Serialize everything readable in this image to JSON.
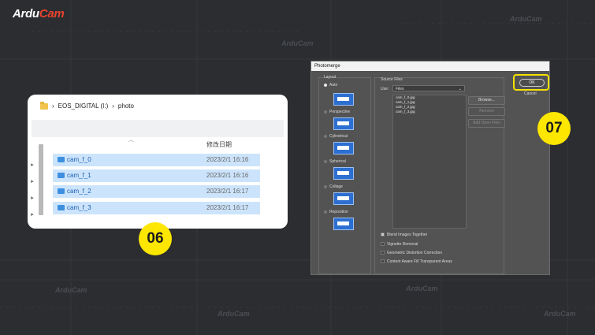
{
  "brand": {
    "name_part1": "Ardu",
    "name_part2": "Cam"
  },
  "watermarks": [
    "ArduCam",
    "ArduCam",
    "ArduCam",
    "ArduCam",
    "ArduCam",
    "ArduCam"
  ],
  "explorer": {
    "breadcrumb": [
      "EOS_DIGITAL (I:)",
      "photo"
    ],
    "separator": "›",
    "column_date": "修改日期",
    "files": [
      {
        "name": "cam_f_0",
        "date": "2023/2/1 16:16"
      },
      {
        "name": "cam_f_1",
        "date": "2023/2/1 16:16"
      },
      {
        "name": "cam_f_2",
        "date": "2023/2/1 16:17"
      },
      {
        "name": "cam_f_3",
        "date": "2023/2/1 16:17"
      }
    ]
  },
  "dialog": {
    "title": "Photomerge",
    "layout_heading": "Layout",
    "layout_options": [
      "Auto",
      "Perspective",
      "Cylindrical",
      "Spherical",
      "Collage",
      "Reposition"
    ],
    "source_heading": "Source Files",
    "use_label": "Use:",
    "use_value": "Files",
    "source_files": [
      "cam_f_0.jpg",
      "cam_f_1.jpg",
      "cam_f_2.jpg",
      "cam_f_3.jpg"
    ],
    "browse_label": "Browse...",
    "remove_label": "Remove",
    "add_open_label": "Add Open Files",
    "ok_label": "OK",
    "cancel_label": "Cancel",
    "options": [
      {
        "label": "Blend Images Together",
        "checked": true
      },
      {
        "label": "Vignette Removal",
        "checked": false
      },
      {
        "label": "Geometric Distortion Correction",
        "checked": false
      },
      {
        "label": "Content Aware Fill Transparent Areas",
        "checked": false
      }
    ]
  },
  "steps": {
    "step_a": "06",
    "step_b": "07"
  },
  "colors": {
    "background": "#2b2d30",
    "accent_yellow": "#fde600",
    "brand_red": "#e8432f",
    "selection": "#cce4fb"
  }
}
